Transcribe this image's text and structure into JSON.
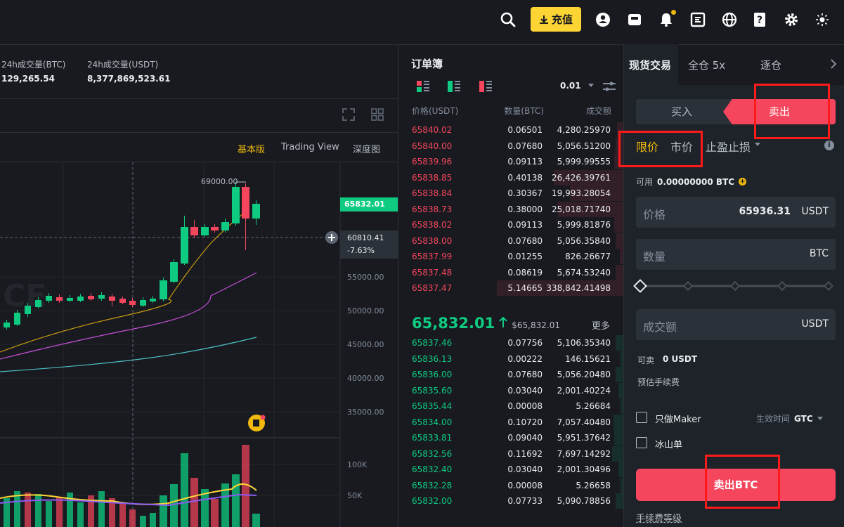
{
  "topbar": {
    "deposit_label": "充值",
    "icons": [
      "search-icon",
      "download-icon",
      "user-icon",
      "wallet-icon",
      "bell-icon",
      "orders-icon",
      "globe-icon",
      "help-icon",
      "gear-icon",
      "theme-icon"
    ]
  },
  "stats": [
    {
      "label": "24h成交量(BTC)",
      "value": "129,265.54"
    },
    {
      "label": "24h成交量(USDT)",
      "value": "8,377,869,523.61"
    }
  ],
  "chart": {
    "tabs": [
      "基本版",
      "Trading View",
      "深度图"
    ],
    "active_tab": "基本版",
    "high_label": "69000.00",
    "last_price_tag": "65832.01",
    "crosshair_price": "60810.41",
    "crosshair_change": "-7.63%",
    "price_axis": [
      "55000.00",
      "50000.00",
      "45000.00",
      "40000.00",
      "35000.00"
    ],
    "volume_axis": [
      "100K",
      "50K"
    ],
    "watermark": "CE"
  },
  "orderbook": {
    "title": "订单簿",
    "precision": "0.01",
    "headers": {
      "price": "价格(USDT)",
      "qty": "数量(BTC)",
      "total": "成交额"
    },
    "asks": [
      {
        "price": "65840.02",
        "qty": "0.06501",
        "total": "4,280.25970",
        "depth": 0.05
      },
      {
        "price": "65840.00",
        "qty": "0.07680",
        "total": "5,056.51200",
        "depth": 0.06
      },
      {
        "price": "65839.96",
        "qty": "0.09113",
        "total": "5,999.99555",
        "depth": 0.07
      },
      {
        "price": "65838.85",
        "qty": "0.40138",
        "total": "26,426.39761",
        "depth": 0.55
      },
      {
        "price": "65838.84",
        "qty": "0.30367",
        "total": "19,993.28054",
        "depth": 0.42
      },
      {
        "price": "65838.73",
        "qty": "0.38000",
        "total": "25,018.71740",
        "depth": 0.52
      },
      {
        "price": "65838.02",
        "qty": "0.09113",
        "total": "5,999.81876",
        "depth": 0.07
      },
      {
        "price": "65838.00",
        "qty": "0.07680",
        "total": "5,056.35840",
        "depth": 0.06
      },
      {
        "price": "65837.99",
        "qty": "0.01255",
        "total": "826.26677",
        "depth": 0.03
      },
      {
        "price": "65837.48",
        "qty": "0.08619",
        "total": "5,674.53240",
        "depth": 0.06
      },
      {
        "price": "65837.47",
        "qty": "5.14665",
        "total": "338,842.41498",
        "depth": 1.0
      }
    ],
    "last_price": "65,832.01",
    "last_price_usd": "$65,832.01",
    "more_label": "更多",
    "bids": [
      {
        "price": "65837.46",
        "qty": "0.07756",
        "total": "5,106.35340",
        "depth": 0.06
      },
      {
        "price": "65836.13",
        "qty": "0.00222",
        "total": "146.15621",
        "depth": 0.02
      },
      {
        "price": "65836.00",
        "qty": "0.07680",
        "total": "5,056.20480",
        "depth": 0.06
      },
      {
        "price": "65835.60",
        "qty": "0.03040",
        "total": "2,001.40224",
        "depth": 0.04
      },
      {
        "price": "65835.44",
        "qty": "0.00008",
        "total": "5.26684",
        "depth": 0.02
      },
      {
        "price": "65834.00",
        "qty": "0.10720",
        "total": "7,057.40480",
        "depth": 0.08
      },
      {
        "price": "65833.81",
        "qty": "0.09040",
        "total": "5,951.37642",
        "depth": 0.07
      },
      {
        "price": "65832.56",
        "qty": "0.11692",
        "total": "7,697.14292",
        "depth": 0.09
      },
      {
        "price": "65832.40",
        "qty": "0.03040",
        "total": "2,001.30496",
        "depth": 0.04
      },
      {
        "price": "65832.28",
        "qty": "0.00008",
        "total": "5.26658",
        "depth": 0.02
      },
      {
        "price": "65832.00",
        "qty": "0.07733",
        "total": "5,090.78856",
        "depth": 0.06
      }
    ]
  },
  "trade": {
    "tabs": [
      "现货交易",
      "全仓 5x",
      "逐仓"
    ],
    "buy_label": "买入",
    "sell_label": "卖出",
    "order_types": [
      "限价",
      "市价",
      "止盈止损"
    ],
    "available_label": "可用",
    "available_value": "0.00000000 BTC",
    "price_label": "价格",
    "price_value": "65936.31",
    "price_unit": "USDT",
    "qty_label": "数量",
    "qty_unit": "BTC",
    "total_label": "成交额",
    "total_unit": "USDT",
    "sellable_label": "可卖",
    "sellable_value": "0 USDT",
    "fee_estimate_label": "预估手续费",
    "maker_only_label": "只做Maker",
    "tif_label": "生效时间",
    "tif_value": "GTC",
    "iceberg_label": "冰山单",
    "submit_label": "卖出BTC",
    "fee_tier_label": "手续费等级"
  },
  "colors": {
    "background": "#181a20",
    "up": "#0ecb81",
    "down": "#f6465d",
    "accent": "#f0b90b",
    "deposit": "#fcd535",
    "highlight_box": "#ff1a1a"
  }
}
